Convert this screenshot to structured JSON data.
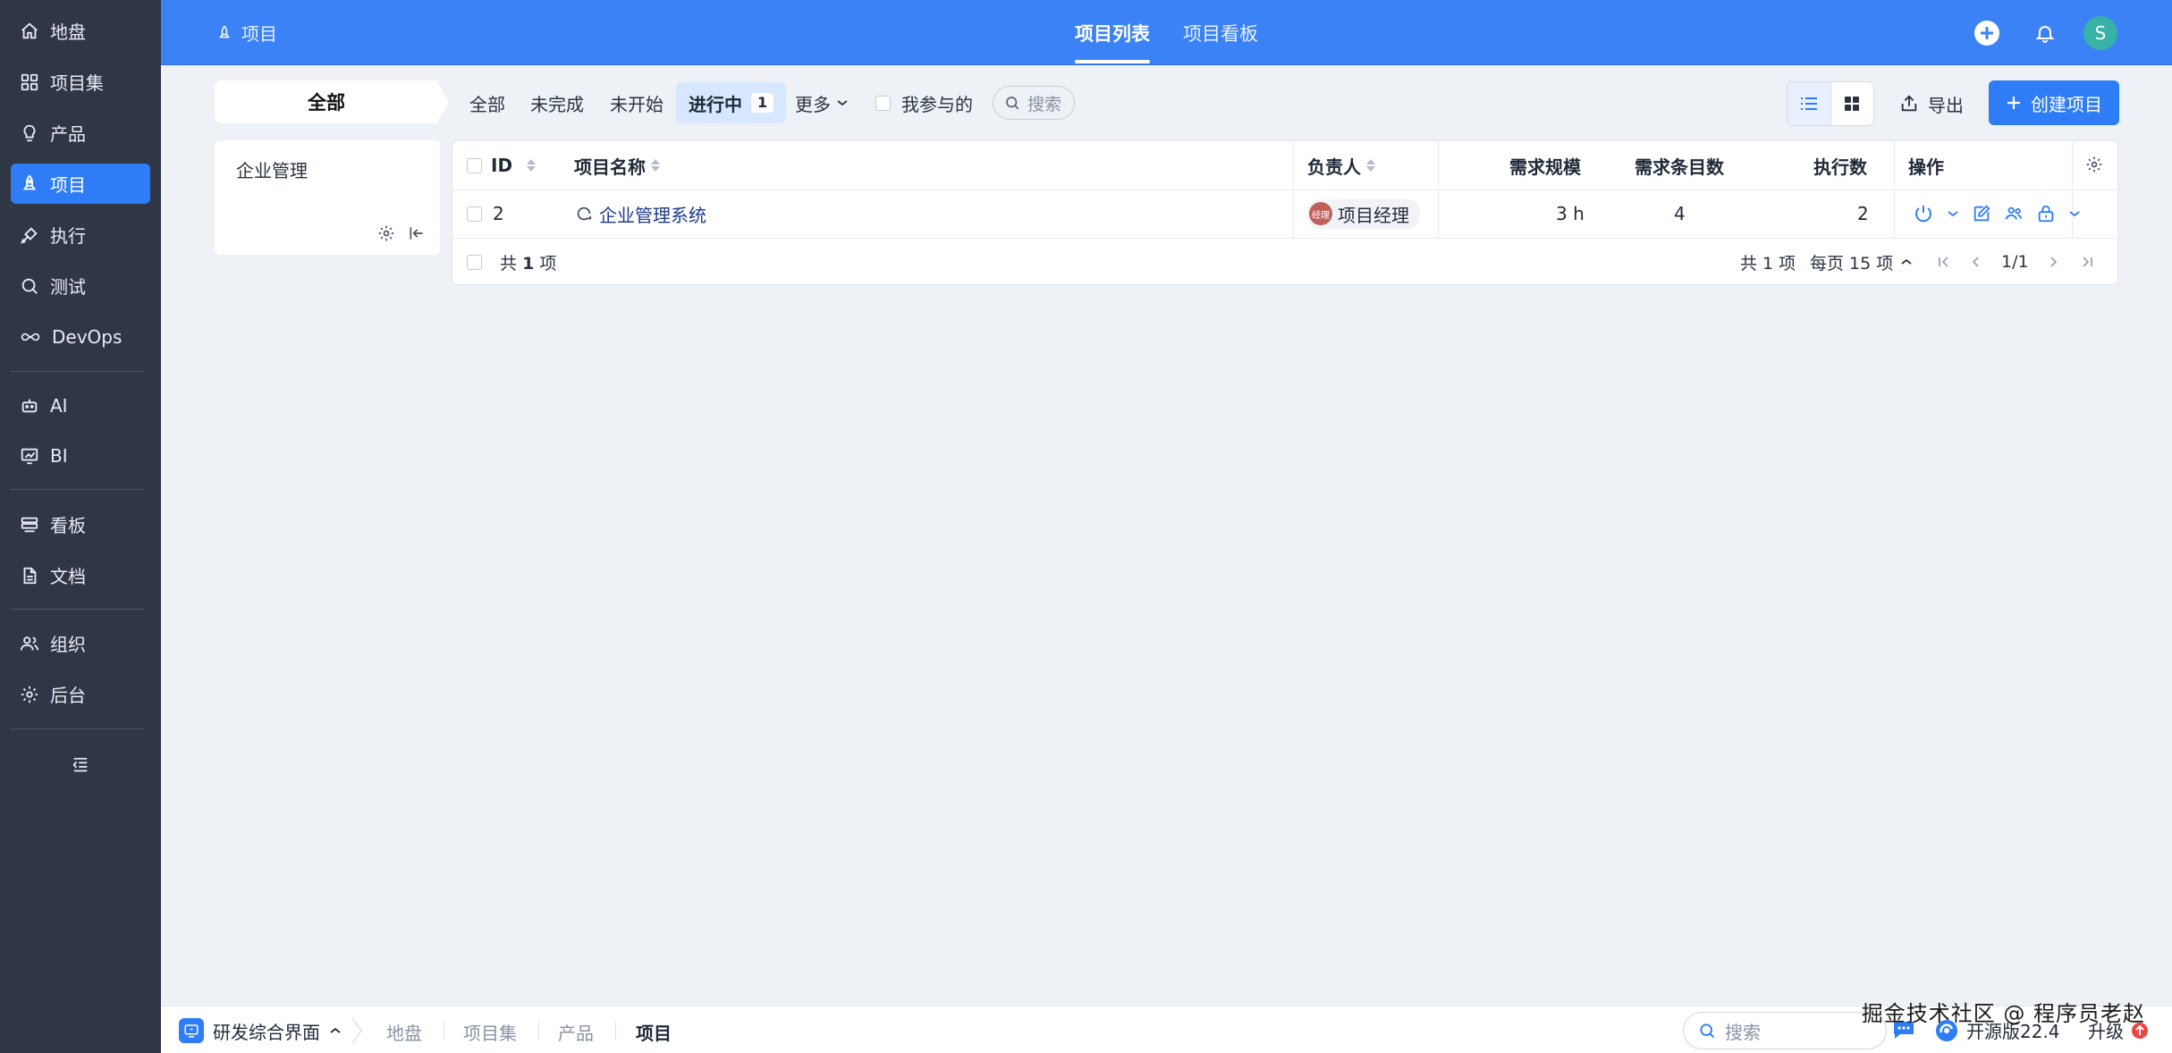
{
  "sidebar": {
    "items": [
      {
        "label": "地盘",
        "icon": "home-icon"
      },
      {
        "label": "项目集",
        "icon": "grid-icon"
      },
      {
        "label": "产品",
        "icon": "lightbulb-icon"
      },
      {
        "label": "项目",
        "icon": "rocket-icon",
        "active": true
      },
      {
        "label": "执行",
        "icon": "launch-icon"
      },
      {
        "label": "测试",
        "icon": "magnifier-icon"
      },
      {
        "label": "DevOps",
        "icon": "infinity-icon"
      },
      {
        "label": "AI",
        "icon": "robot-icon"
      },
      {
        "label": "BI",
        "icon": "chart-icon"
      },
      {
        "label": "看板",
        "icon": "board-icon"
      },
      {
        "label": "文档",
        "icon": "document-icon"
      },
      {
        "label": "组织",
        "icon": "people-icon"
      },
      {
        "label": "后台",
        "icon": "gear-icon"
      }
    ]
  },
  "header": {
    "breadcrumb": "项目",
    "tabs": [
      {
        "label": "项目列表",
        "active": true
      },
      {
        "label": "项目看板",
        "active": false
      }
    ],
    "avatar_letter": "S"
  },
  "toolbar": {
    "scope": "全部",
    "filters": [
      "全部",
      "未完成",
      "未开始",
      "进行中",
      "更多"
    ],
    "active_filter_count": "1",
    "mine_label": "我参与的",
    "search_placeholder": "搜索",
    "export_label": "导出",
    "create_label": "创建项目"
  },
  "tree": {
    "item": "企业管理"
  },
  "table": {
    "columns": [
      "ID",
      "项目名称",
      "负责人",
      "需求规模",
      "需求条目数",
      "执行数",
      "操作"
    ],
    "rows": [
      {
        "id": "2",
        "name": "企业管理系统",
        "owner_badge": "经理",
        "owner": "项目经理",
        "scale": "3 h",
        "stories": "4",
        "executions": "2"
      }
    ],
    "summary_prefix": "共",
    "summary_count": "1",
    "summary_suffix": "项",
    "pager_total": "共 1 项",
    "pager_per_page": "每页 15 项",
    "pager_page": "1/1"
  },
  "footer": {
    "app": "研发综合界面",
    "crumbs": [
      "地盘",
      "项目集",
      "产品",
      "项目"
    ],
    "search_placeholder": "搜索",
    "version": "开源版22.4",
    "upgrade": "升级"
  },
  "watermark": "掘金技术社区 @ 程序员老赵",
  "colors": {
    "sidebar_bg": "#2f3747",
    "header_bg": "#3b82f6",
    "accent": "#2e7df6"
  }
}
